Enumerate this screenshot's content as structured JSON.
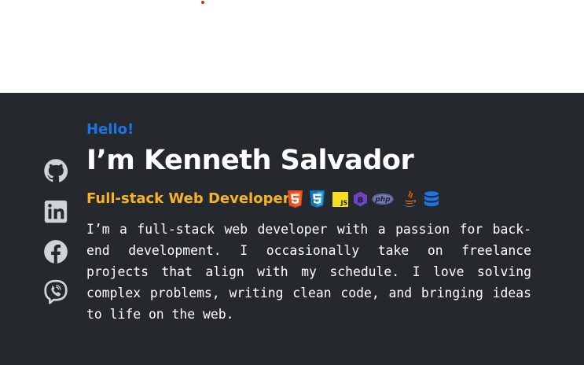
{
  "hero": {
    "greeting": "Hello!",
    "name": "I’m Kenneth Salvador",
    "role": "Full-stack Web Developer",
    "bio": "I’m a full-stack web developer with a passion for back-end development. I occasionally take on freelance projects that align with my schedule. I love solving complex problems, writing clean code, and bringing ideas to life on the web.",
    "tech_icons": [
      "html5-icon",
      "css3-icon",
      "javascript-icon",
      "bootstrap-icon",
      "php-icon",
      "java-icon",
      "database-icon"
    ],
    "tech_labels": {
      "javascript": "JS",
      "bootstrap": "B",
      "php": "php"
    }
  },
  "socials": [
    "github-icon",
    "linkedin-icon",
    "facebook-icon",
    "viber-icon"
  ],
  "colors": {
    "background": "#25282c",
    "greeting": "#1e74e6",
    "role": "#f6b325",
    "text": "#ffffff",
    "social_icon": "#cfd3d8"
  }
}
